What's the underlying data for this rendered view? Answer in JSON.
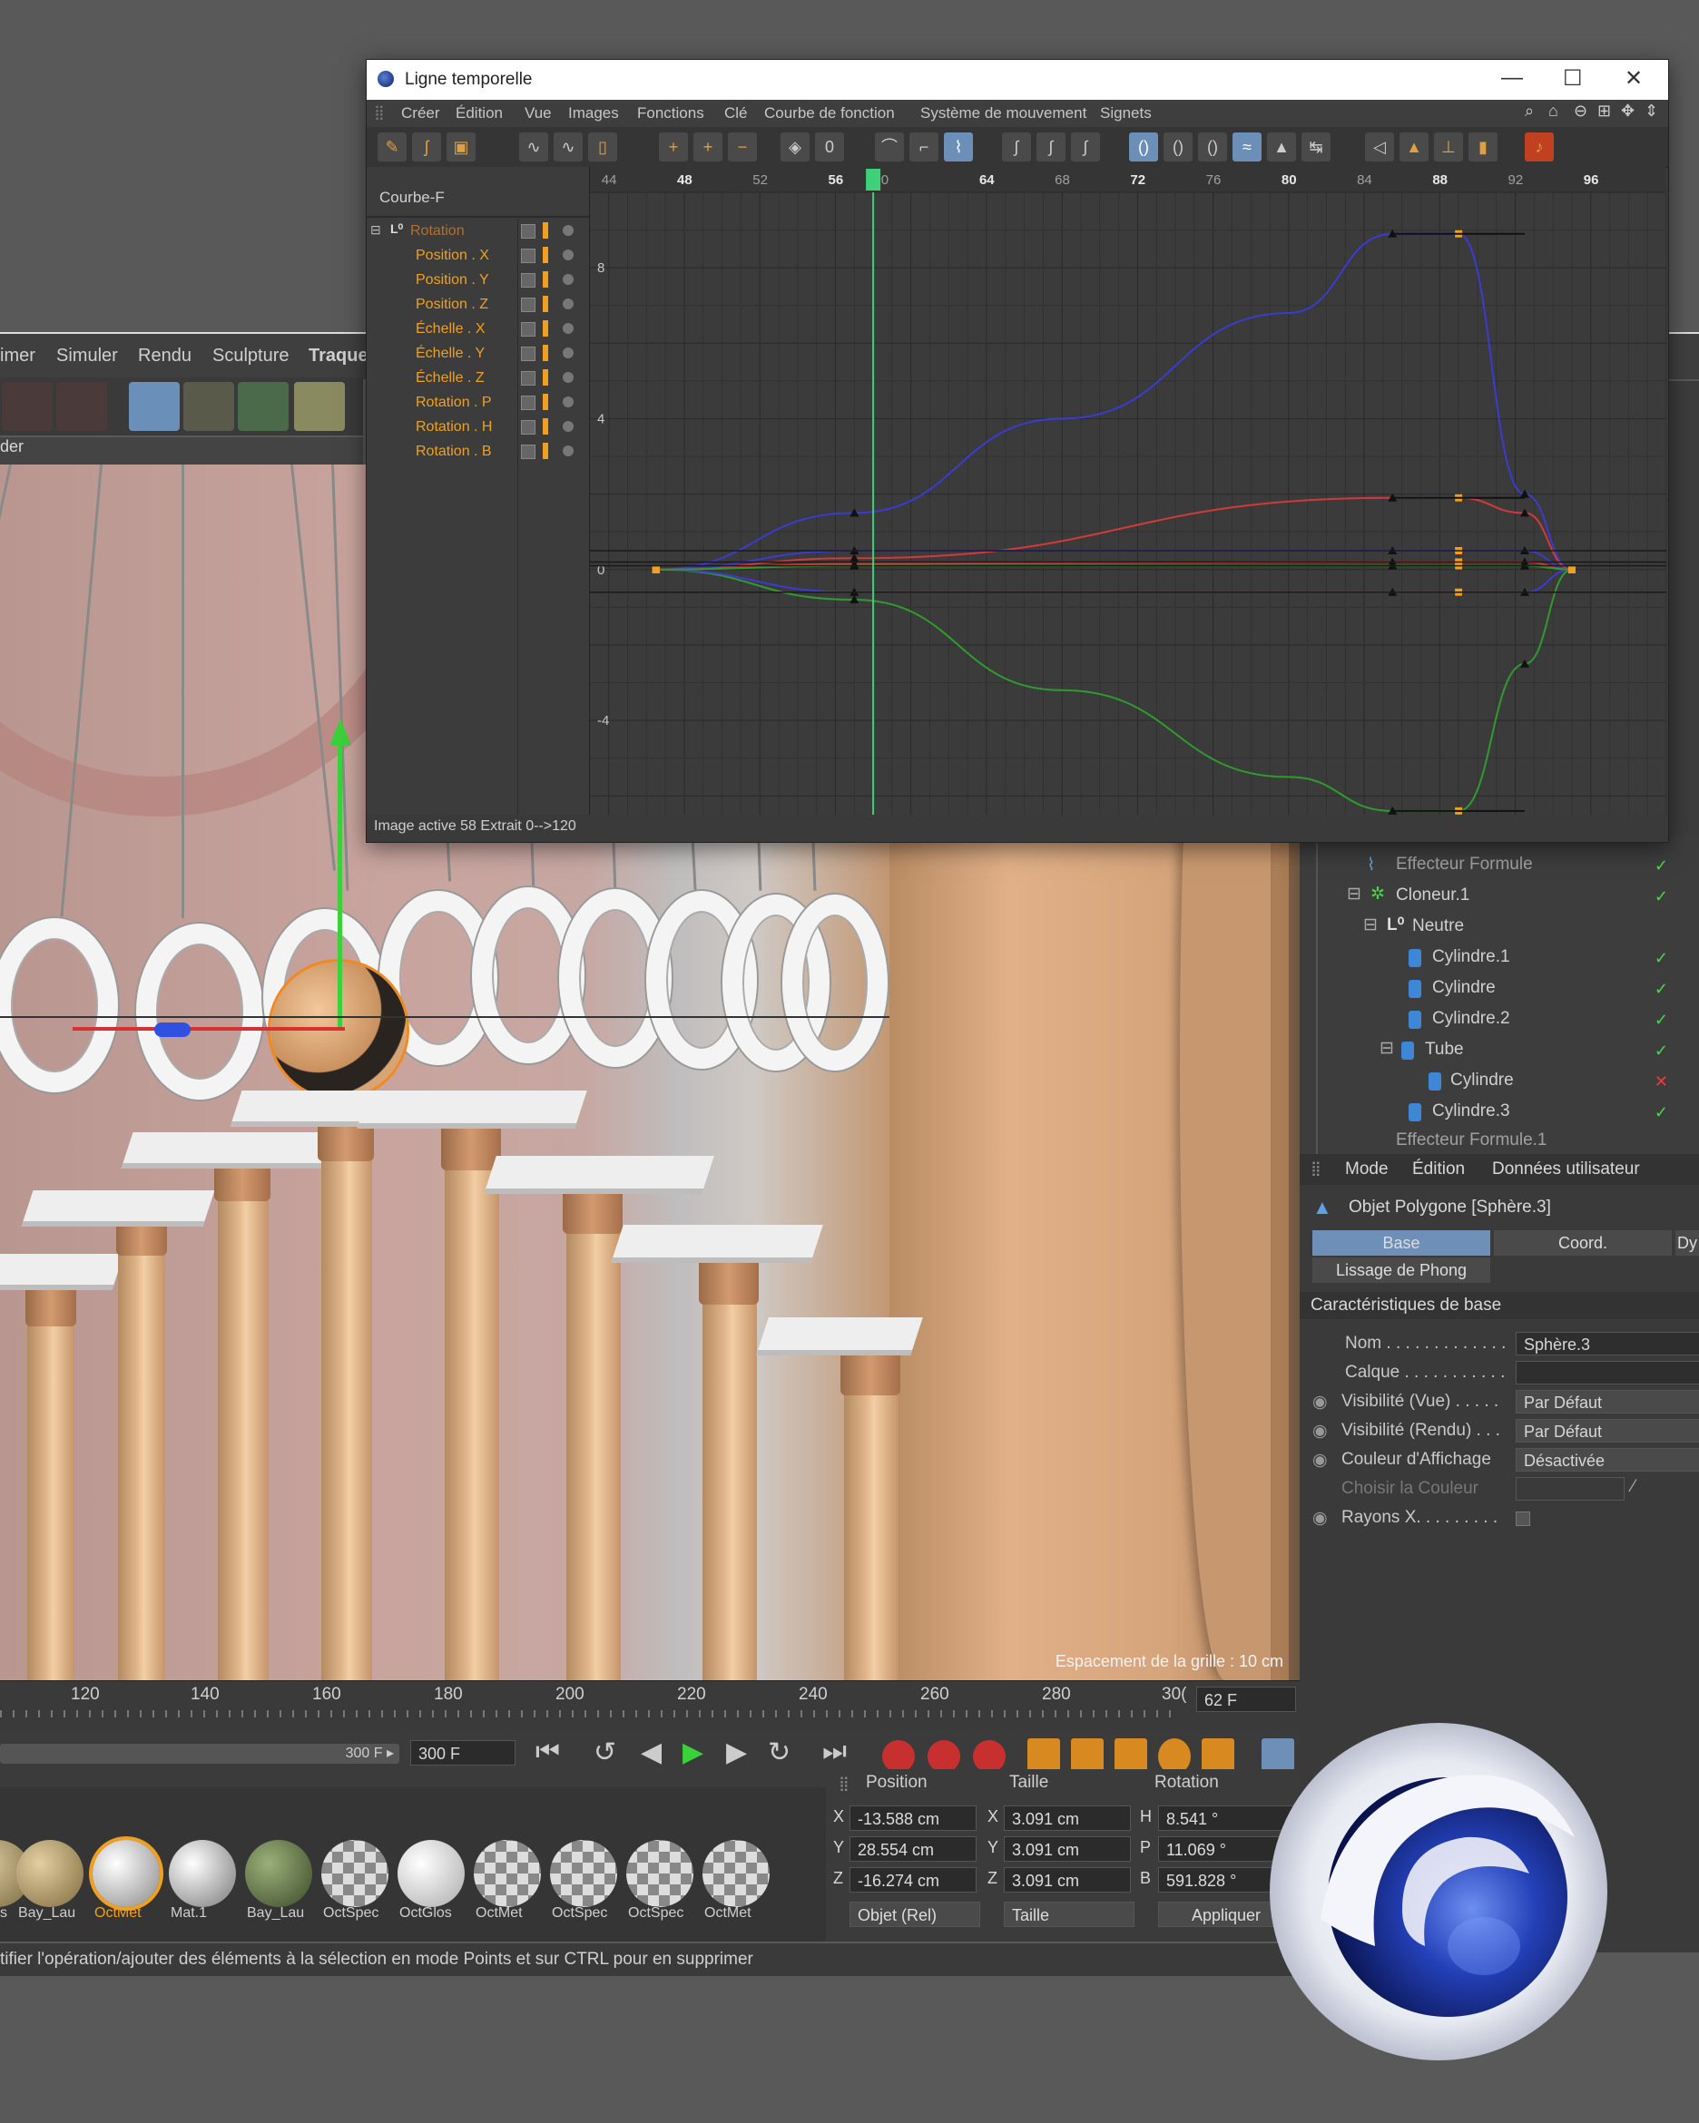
{
  "back_window": {
    "menu": [
      "imer",
      "Simuler",
      "Rendu",
      "Sculpture",
      "Traque"
    ],
    "viewport_header": "der",
    "viewport_overlay": "Espacement de la grille : 10 cm"
  },
  "object_manager": {
    "items": [
      {
        "label": "Effecteur Formule",
        "indent": 0
      },
      {
        "label": "Cloneur.1",
        "indent": 0
      },
      {
        "label": "Neutre",
        "indent": 1
      },
      {
        "label": "Cylindre.1",
        "indent": 2
      },
      {
        "label": "Cylindre",
        "indent": 2
      },
      {
        "label": "Cylindre.2",
        "indent": 2
      },
      {
        "label": "Tube",
        "indent": 2
      },
      {
        "label": "Cylindre",
        "indent": 3
      },
      {
        "label": "Cylindre.3",
        "indent": 2
      },
      {
        "label": "Effecteur Formule.1",
        "indent": 0
      }
    ]
  },
  "attributes": {
    "menu": [
      "Mode",
      "Édition",
      "Données utilisateur"
    ],
    "object_title": "Objet Polygone [Sphère.3]",
    "tabs": [
      "Base",
      "Coord.",
      "Dy"
    ],
    "tab2": "Lissage de Phong",
    "section": "Caractéristiques de base",
    "rows": [
      {
        "label": "Nom . . . . . . . . . . . . .",
        "value": "Sphère.3"
      },
      {
        "label": "Calque . . . . . . . . . . .",
        "value": ""
      },
      {
        "label": "Visibilité (Vue) . . . . .",
        "value": "Par Défaut"
      },
      {
        "label": "Visibilité (Rendu) . . .",
        "value": "Par Défaut"
      },
      {
        "label": "Couleur d'Affichage",
        "value": "Désactivée"
      },
      {
        "label": "Choisir la Couleur",
        "value": ""
      },
      {
        "label": "Rayons X. . . . . . . . .",
        "value": ""
      }
    ]
  },
  "bottom": {
    "ruler_ticks": [
      "120",
      "140",
      "160",
      "180",
      "200",
      "220",
      "240",
      "260",
      "280",
      "30("
    ],
    "frame_field": "62 F",
    "end_frame_a": "300 F ▸",
    "end_frame_b": "300 F",
    "coord_headers": [
      "Position",
      "Taille",
      "Rotation"
    ],
    "coords": [
      {
        "axis": "X",
        "pos": "-13.588 cm",
        "size_axis": "X",
        "size": "3.091 cm",
        "rot_axis": "H",
        "rot": "8.541 °"
      },
      {
        "axis": "Y",
        "pos": "28.554 cm",
        "size_axis": "Y",
        "size": "3.091 cm",
        "rot_axis": "P",
        "rot": "11.069 °"
      },
      {
        "axis": "Z",
        "pos": "-16.274 cm",
        "size_axis": "Z",
        "size": "3.091 cm",
        "rot_axis": "B",
        "rot": "591.828 °"
      }
    ],
    "coord_mode": "Objet (Rel)",
    "size_mode": "Taille",
    "apply": "Appliquer",
    "materials": [
      "s",
      "Bay_Lau",
      "OctMet",
      "Mat.1",
      "Bay_Lau",
      "OctSpec",
      "OctGlos",
      "OctMet",
      "OctSpec",
      "OctSpec",
      "OctMet"
    ],
    "status": "tifier l'opération/ajouter des éléments à la sélection en mode Points et sur CTRL pour en supprimer"
  },
  "timeline_window": {
    "title": "Ligne temporelle",
    "controls": [
      "—",
      "☐",
      "✕"
    ],
    "menu": [
      "Créer",
      "Édition",
      "Vue",
      "Images",
      "Fonctions",
      "Clé",
      "Courbe de fonction",
      "Système de mouvement",
      "Signets"
    ],
    "left_title": "Courbe-F",
    "tracks": [
      "Rotation",
      "Position . X",
      "Position . Y",
      "Position . Z",
      "Échelle . X",
      "Échelle . Y",
      "Échelle . Z",
      "Rotation . P",
      "Rotation . H",
      "Rotation . B"
    ],
    "ruler": [
      "44",
      "48",
      "52",
      "56",
      "580",
      "64",
      "68",
      "72",
      "76",
      "80",
      "84",
      "88",
      "92",
      "96"
    ],
    "y_labels": [
      "8",
      "4",
      "0",
      "-4"
    ],
    "status": "Image active  58  Extrait  0-->120",
    "current_frame": 58
  },
  "chart_data": {
    "type": "line",
    "xlim": [
      43,
      100
    ],
    "ylim": [
      -6.5,
      10
    ],
    "series": [
      {
        "color": "#3b3bd0",
        "x": [
          46.5,
          57,
          68,
          80,
          85.5,
          89,
          92.5,
          95
        ],
        "y": [
          0,
          1.5,
          4,
          6.8,
          8.9,
          8.9,
          2,
          0
        ]
      },
      {
        "color": "#2f9b2f",
        "x": [
          46.5,
          57,
          68,
          80,
          85.5,
          89,
          92.5,
          95
        ],
        "y": [
          0,
          -0.8,
          -3.2,
          -5.5,
          -6.4,
          -6.4,
          -2.5,
          0
        ]
      },
      {
        "color": "#d03a3a",
        "x": [
          46.5,
          57,
          85.5,
          89,
          92.5,
          95
        ],
        "y": [
          0,
          0.3,
          1.9,
          1.9,
          1.5,
          0
        ]
      },
      {
        "color": "#3b3bd0",
        "x": [
          46.5,
          57,
          85.5,
          89,
          92.5,
          95
        ],
        "y": [
          0,
          0.5,
          0.5,
          0.5,
          0.5,
          0
        ]
      },
      {
        "color": "#3b3bd0",
        "x": [
          46.5,
          57,
          85.5,
          89,
          92.5,
          95
        ],
        "y": [
          0,
          -0.6,
          -0.6,
          -0.6,
          -0.6,
          0
        ]
      },
      {
        "color": "#d03a3a",
        "x": [
          46.5,
          57,
          85.5,
          89,
          92.5,
          95
        ],
        "y": [
          0,
          0.15,
          0.2,
          0.2,
          0.2,
          0
        ]
      },
      {
        "color": "#2f9b2f",
        "x": [
          46.5,
          57,
          85.5,
          89,
          92.5,
          95
        ],
        "y": [
          0,
          0.1,
          0.1,
          0.1,
          0.1,
          0
        ]
      }
    ]
  },
  "colors": {
    "accent": "#f0a020",
    "playhead": "#3fd07a",
    "window_bg": "#3a3a3a"
  }
}
